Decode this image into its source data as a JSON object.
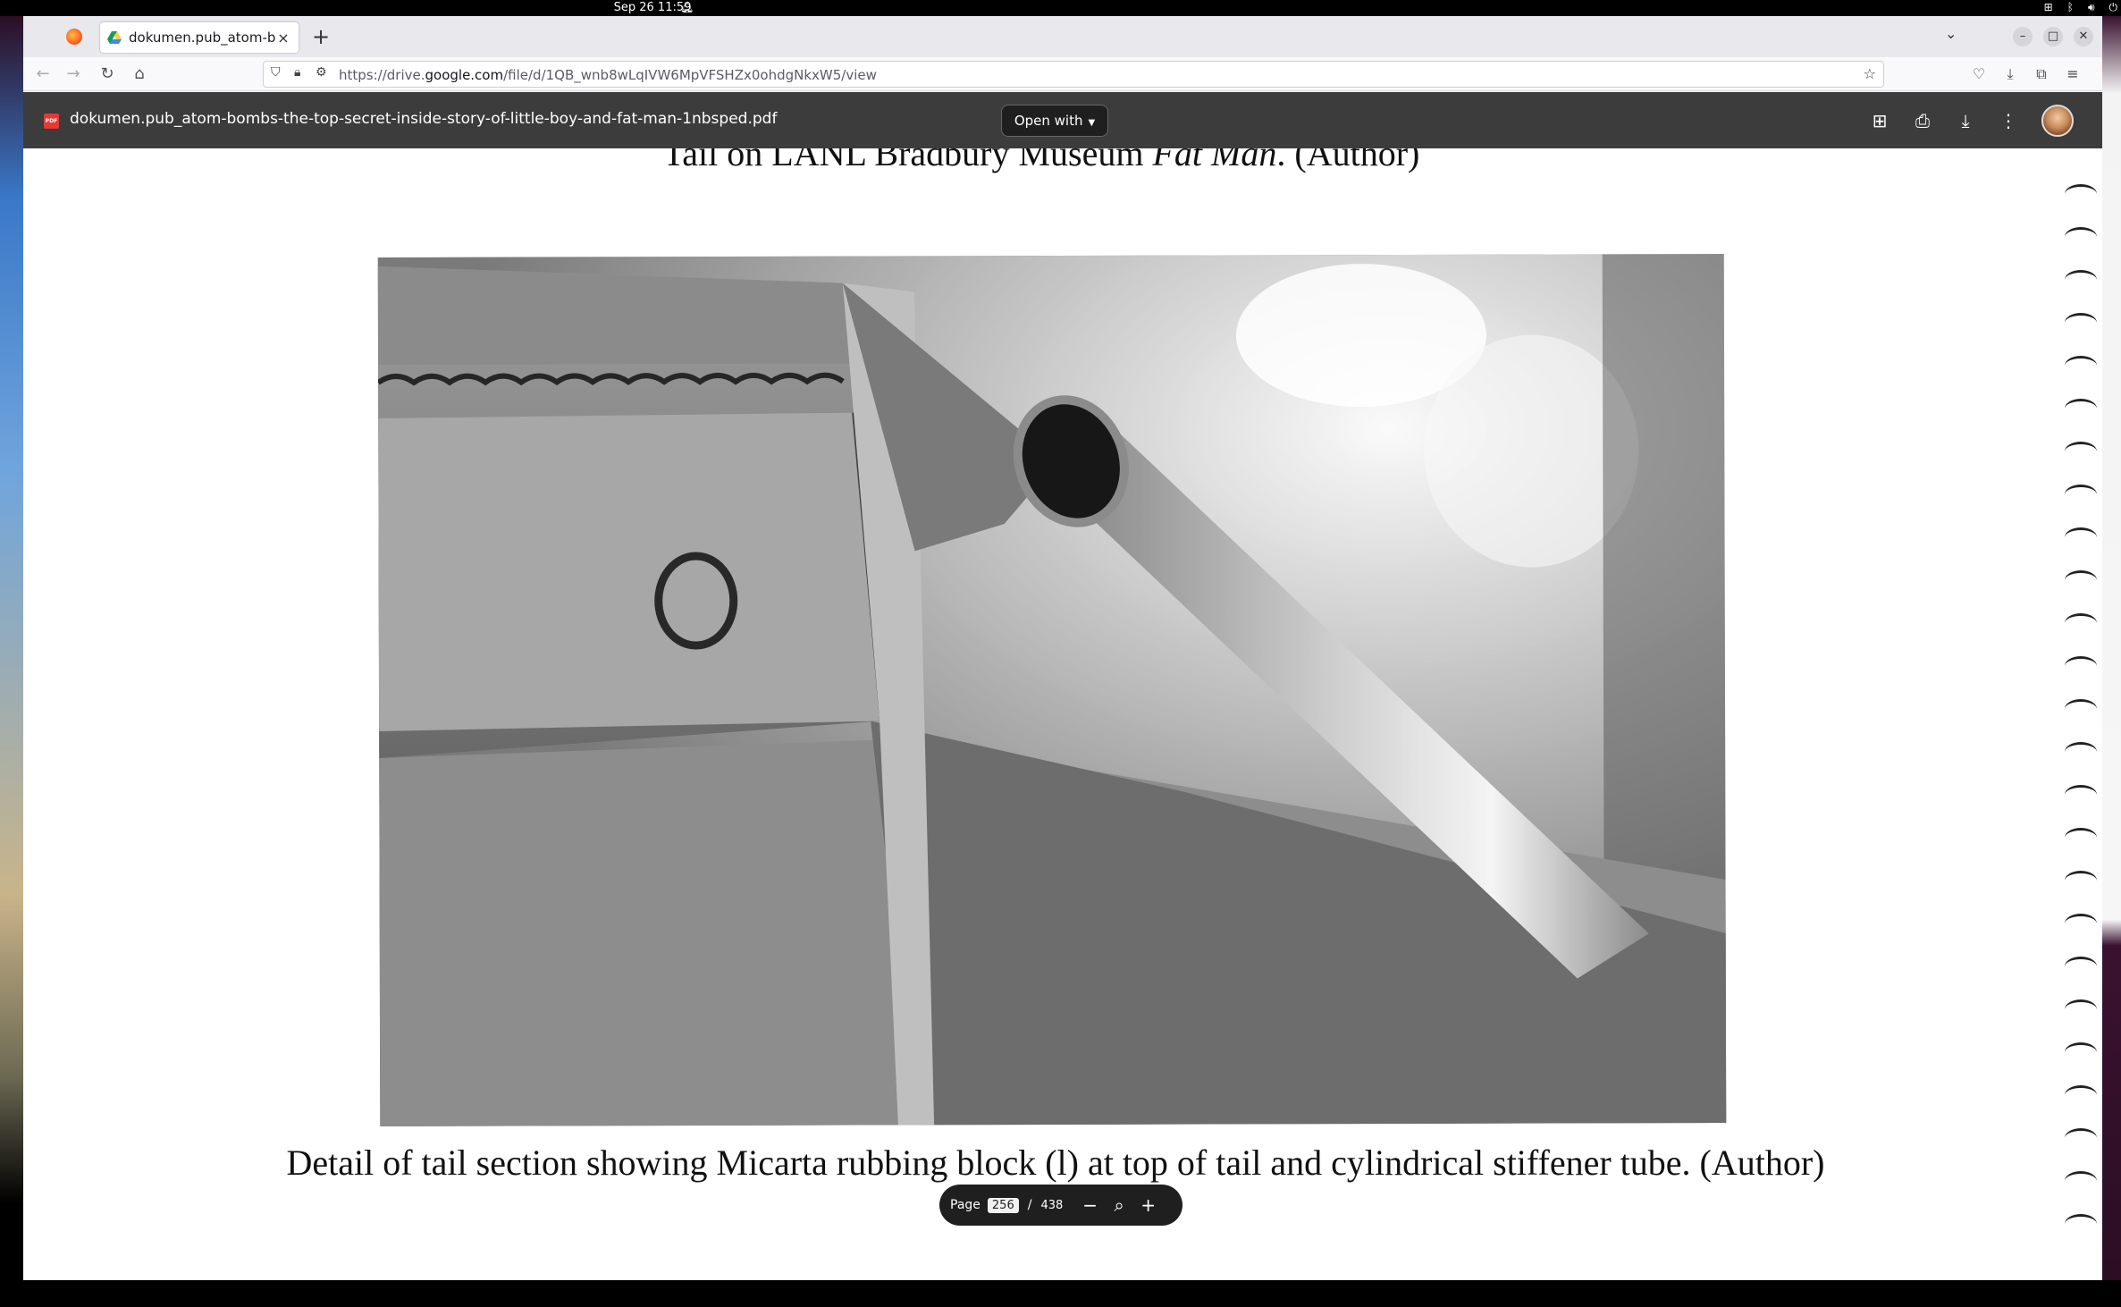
{
  "system_bar": {
    "clock": "Sep 26  11:59"
  },
  "browser": {
    "tab": {
      "title": "dokumen.pub_atom-bom",
      "close": "×"
    },
    "new_tab": "+",
    "url_host_prefix": "https://drive.",
    "url_host": "google.com",
    "url_path": "/file/d/1QB_wnb8wLqIVW6MpVFSHZx0ohdgNkxW5/view"
  },
  "viewer": {
    "file_badge": "PDF",
    "filename": "dokumen.pub_atom-bombs-the-top-secret-inside-story-of-little-boy-and-fat-man-1nbsped.pdf",
    "open_with": "Open with"
  },
  "document": {
    "previous_caption_before": "Tail on LANL Bradbury Museum ",
    "previous_caption_italic": "Fat Man",
    "previous_caption_after": ".  (Author)",
    "caption": "Detail of tail section showing Micarta rubbing block (l) at top of tail and cylindrical stiffener tube.  (Author)"
  },
  "page_control": {
    "label": "Page",
    "current": "256",
    "separator": "/",
    "total": "438"
  },
  "icons": [
    "firefox-icon",
    "google-drive-icon",
    "back-icon",
    "forward-icon",
    "reload-icon",
    "home-icon",
    "shield-icon",
    "lock-icon",
    "permissions-icon",
    "bookmark-star-icon",
    "pocket-icon",
    "downloads-icon",
    "extensions-icon",
    "menu-icon",
    "add-comment-icon",
    "print-icon",
    "download-icon",
    "more-options-icon",
    "zoom-out-icon",
    "zoom-icon",
    "zoom-in-icon"
  ]
}
